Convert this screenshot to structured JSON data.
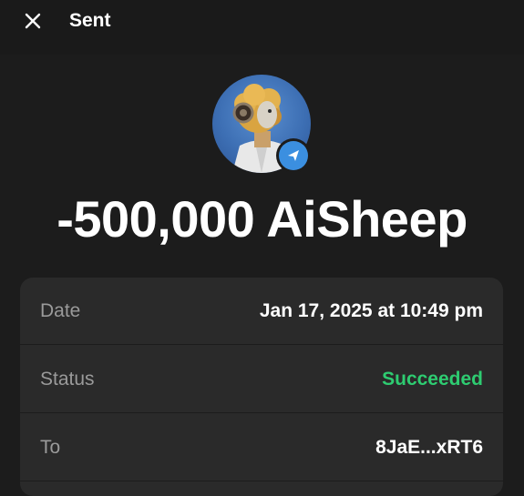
{
  "header": {
    "title": "Sent",
    "close_icon": "close-icon"
  },
  "transaction": {
    "amount": "-500,000 AiSheep",
    "avatar_icon": "token-avatar",
    "badge_icon": "send-arrow-icon"
  },
  "details": {
    "rows": [
      {
        "label": "Date",
        "value": "Jan 17, 2025 at 10:49 pm"
      },
      {
        "label": "Status",
        "value": "Succeeded"
      },
      {
        "label": "To",
        "value": "8JaE...xRT6"
      }
    ]
  },
  "colors": {
    "background": "#1c1c1c",
    "card": "#2a2a2a",
    "success": "#2ecc71",
    "accent": "#3b8fe0",
    "label": "#9a9a9a"
  }
}
